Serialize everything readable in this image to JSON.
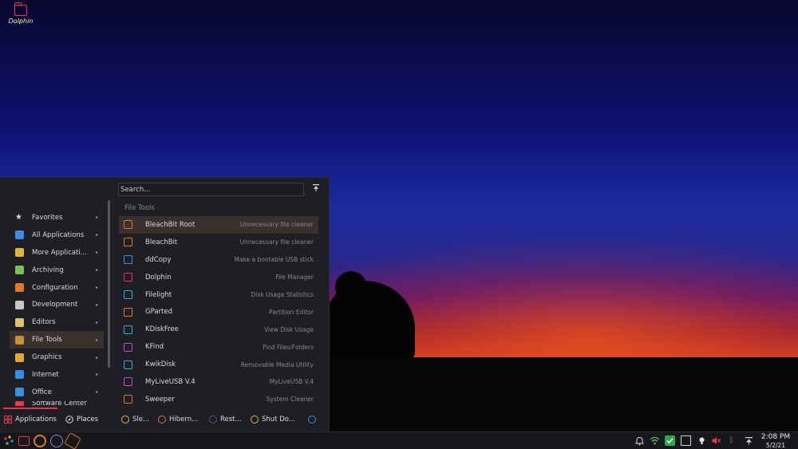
{
  "desktop": {
    "icon_label": "Dolphin"
  },
  "launcher": {
    "search_placeholder": "Search...",
    "section_title": "File Tools",
    "categories": [
      {
        "label": "Favorites",
        "color": "#d6d8da"
      },
      {
        "label": "All Applications",
        "color": "#3d8ee0"
      },
      {
        "label": "More Applicati...",
        "color": "#e0b43a"
      },
      {
        "label": "Archiving",
        "color": "#7cc05a"
      },
      {
        "label": "Configuration",
        "color": "#e07a2a"
      },
      {
        "label": "Development",
        "color": "#c8c8c8"
      },
      {
        "label": "Editors",
        "color": "#e0c070"
      },
      {
        "label": "File Tools",
        "color": "#c8903a"
      },
      {
        "label": "Graphics",
        "color": "#e0a83a"
      },
      {
        "label": "Internet",
        "color": "#3a8ee0"
      },
      {
        "label": "Office",
        "color": "#3a8ee0"
      },
      {
        "label": "Software Center",
        "color": "#e8384f"
      }
    ],
    "apps": [
      {
        "name": "BleachBit Root",
        "desc": "Unnecessary file cleaner",
        "color": "#e07a2a"
      },
      {
        "name": "BleachBit",
        "desc": "Unnecessary file cleaner",
        "color": "#e07a2a"
      },
      {
        "name": "ddCopy",
        "desc": "Make a bootable USB stick",
        "color": "#3a8ee0"
      },
      {
        "name": "Dolphin",
        "desc": "File Manager",
        "color": "#e8384f"
      },
      {
        "name": "Filelight",
        "desc": "Disk Usage Statistics",
        "color": "#3aa8e0"
      },
      {
        "name": "GParted",
        "desc": "Partition Editor",
        "color": "#e07a2a"
      },
      {
        "name": "KDiskFree",
        "desc": "View Disk Usage",
        "color": "#3aa8e0"
      },
      {
        "name": "KFind",
        "desc": "Find Files/Folders",
        "color": "#c84ad0"
      },
      {
        "name": "KwikDisk",
        "desc": "Removable Media Utility",
        "color": "#3aa8e0"
      },
      {
        "name": "MyLiveUSB V.4",
        "desc": "MyLiveUSB V.4",
        "color": "#c84ad0"
      },
      {
        "name": "Sweeper",
        "desc": "System Cleaner",
        "color": "#e07a2a"
      }
    ],
    "tabs": {
      "applications": "Applications",
      "places": "Places"
    },
    "power": {
      "sleep": "Sle...",
      "hibernate": "Hibern...",
      "restart": "Rest...",
      "shutdown": "Shut Do..."
    }
  },
  "taskbar": {
    "time": "2:08 PM",
    "date": "5/2/21"
  }
}
